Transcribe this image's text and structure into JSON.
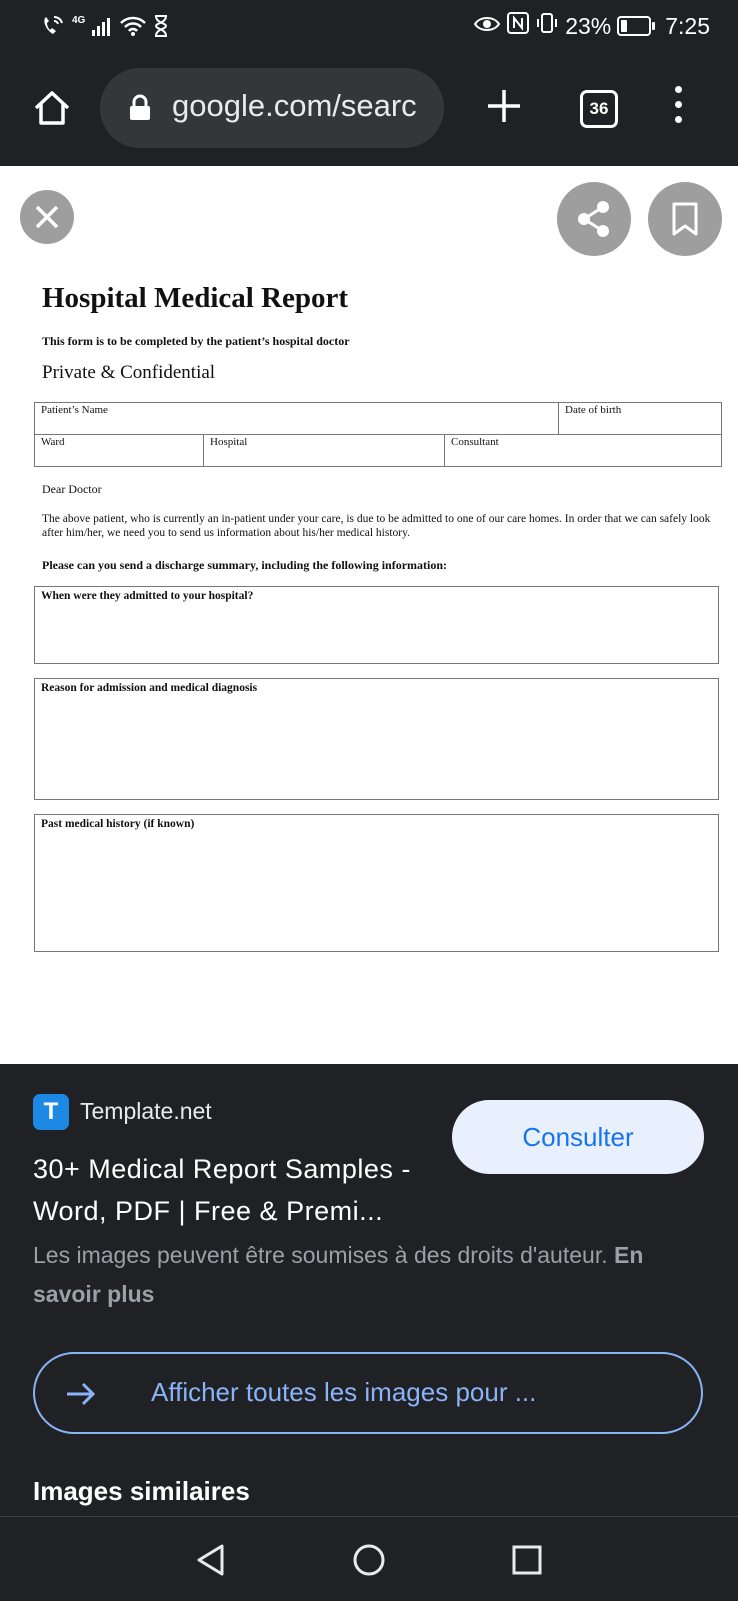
{
  "status_bar": {
    "network_label": "4G",
    "battery_percent": "23%",
    "time": "7:25"
  },
  "toolbar": {
    "url": "google.com/searc",
    "tab_count": "36"
  },
  "document": {
    "title": "Hospital Medical Report",
    "subtitle": "This form is to be completed by the patient’s hospital doctor",
    "confidential": "Private & Confidential",
    "fields": {
      "patient_name": "Patient’s Name",
      "date_of_birth": "Date of birth",
      "ward": "Ward",
      "hospital": "Hospital",
      "consultant": "Consultant"
    },
    "greeting": "Dear Doctor",
    "paragraph": "The above patient, who is currently an in-patient under your care, is due to be admitted to one of our care homes.  In order that we can safely look after him/her, we need you to send us information about his/her medical history.",
    "request": "Please can you send a discharge summary, including the following information:",
    "questions": [
      "When were they admitted to your hospital?",
      "Reason for admission and medical diagnosis",
      "Past medical history (if known)"
    ]
  },
  "details": {
    "source_icon_letter": "T",
    "source_name": "Template.net",
    "result_title": "30+ Medical Report Samples - Word, PDF | Free & Premi...",
    "visit_label": "Consulter",
    "copyright_text": "Les images peuvent être soumises à des droits d'auteur.",
    "learn_more": "En savoir plus",
    "view_all_label": "Afficher toutes les images pour ...",
    "similar_heading": "Images similaires"
  },
  "colors": {
    "background": "#202124",
    "accent_blue": "#8ab4f8",
    "button_bg": "#e8f0fe",
    "button_text": "#1a73e8",
    "favicon_blue": "#1e88e5"
  },
  "icons": [
    "wifi-calling-icon",
    "signal-icon",
    "wifi-icon",
    "hourglass-icon",
    "eye-icon",
    "nfc-icon",
    "vibrate-icon",
    "battery-icon",
    "home-icon",
    "lock-icon",
    "plus-icon",
    "tabs-icon",
    "more-vert-icon",
    "close-icon",
    "share-icon",
    "bookmark-icon",
    "arrow-right-icon",
    "back-triangle-icon",
    "home-circle-icon",
    "recents-square-icon"
  ]
}
